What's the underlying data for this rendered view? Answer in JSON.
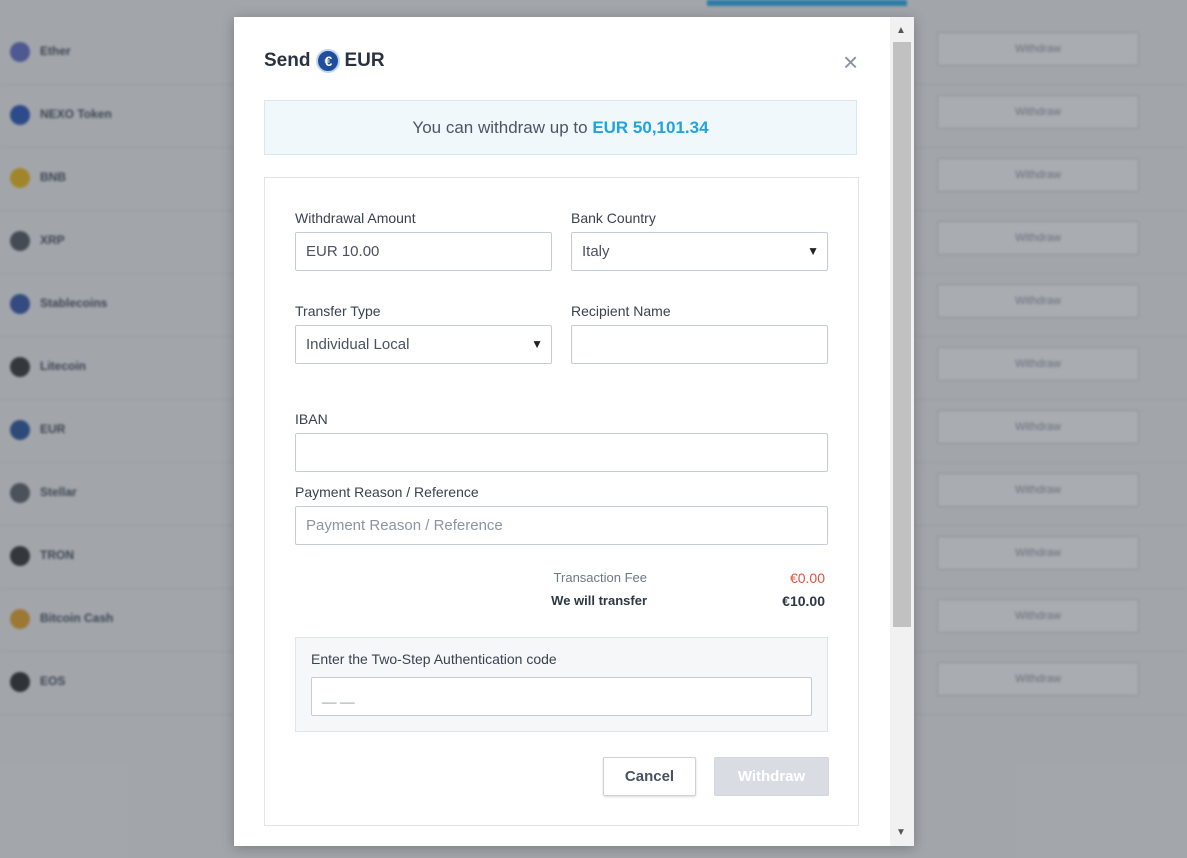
{
  "background": {
    "assets": [
      {
        "name": "Ether",
        "icon": "ether-icon",
        "color": "#5a67c6"
      },
      {
        "name": "NEXO Token",
        "icon": "nexo-icon",
        "color": "#1b4fb8"
      },
      {
        "name": "BNB",
        "icon": "bnb-icon",
        "color": "#f0b90b"
      },
      {
        "name": "XRP",
        "icon": "xrp-icon",
        "color": "#4a4f58"
      },
      {
        "name": "Stablecoins",
        "icon": "stablecoins-icon",
        "color": "#2a4fa8"
      },
      {
        "name": "Litecoin",
        "icon": "litecoin-icon",
        "color": "#2b2b2b"
      },
      {
        "name": "EUR",
        "icon": "eur-icon",
        "color": "#1f4e9c"
      },
      {
        "name": "Stellar",
        "icon": "stellar-icon",
        "color": "#555b63"
      },
      {
        "name": "TRON",
        "icon": "tron-icon",
        "color": "#2a2a2a"
      },
      {
        "name": "Bitcoin Cash",
        "icon": "bitcoin-cash-icon",
        "color": "#e8a020"
      },
      {
        "name": "EOS",
        "icon": "eos-icon",
        "color": "#222"
      }
    ],
    "withdraw_label": "Withdraw"
  },
  "modal": {
    "title_prefix": "Send",
    "coin_symbol": "€",
    "currency": "EUR",
    "close_symbol": "×",
    "limit_text": "You can withdraw up to",
    "limit_amount": "EUR 50,101.34",
    "form": {
      "amount_label": "Withdrawal Amount",
      "amount_value": "EUR 10.00",
      "bank_country_label": "Bank Country",
      "bank_country_value": "Italy",
      "transfer_type_label": "Transfer Type",
      "transfer_type_value": "Individual Local",
      "recipient_label": "Recipient Name",
      "recipient_value": "",
      "iban_label": "IBAN",
      "iban_value": "",
      "reference_label": "Payment Reason / Reference",
      "reference_placeholder": "Payment Reason / Reference"
    },
    "fees": {
      "fee_label": "Transaction Fee",
      "fee_value": "€0.00",
      "total_label": "We will transfer",
      "total_value": "€10.00"
    },
    "tfa": {
      "label": "Enter the Two-Step Authentication code",
      "placeholder": "__ __"
    },
    "buttons": {
      "cancel": "Cancel",
      "withdraw": "Withdraw"
    }
  }
}
